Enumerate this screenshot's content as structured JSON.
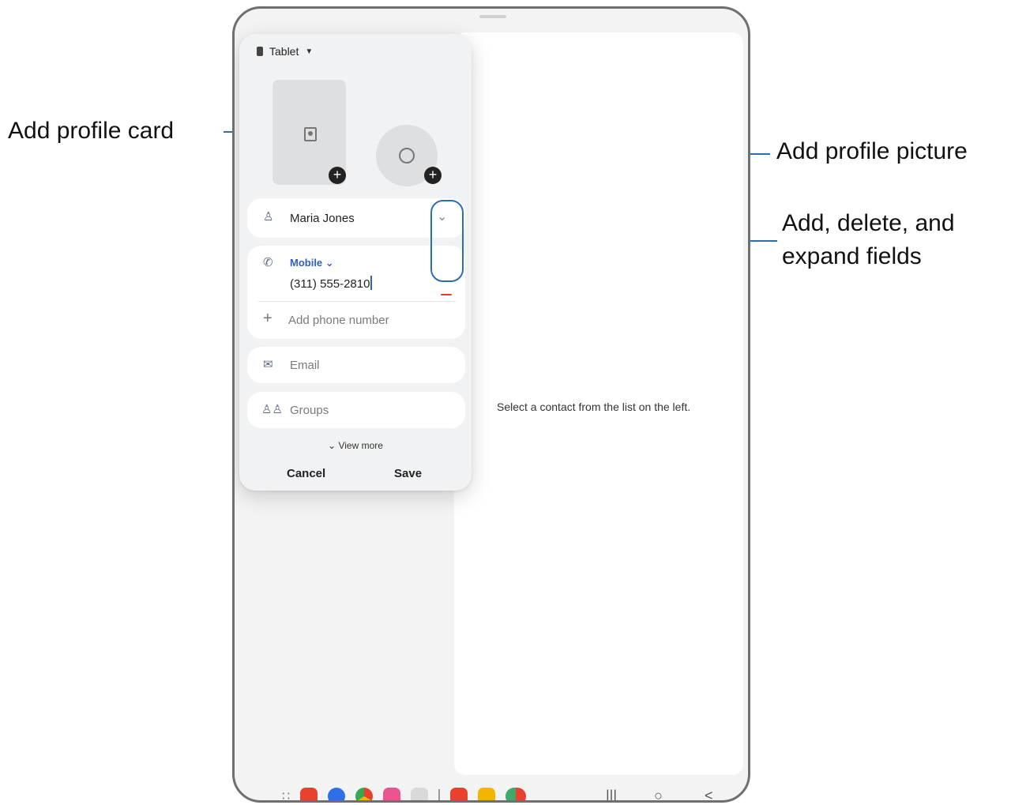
{
  "callouts": {
    "profile_card": "Add profile card",
    "profile_picture": "Add profile picture",
    "fields_line1": "Add, delete, and",
    "fields_line2": "expand fields"
  },
  "editor": {
    "account": "Tablet",
    "name_value": "Maria Jones",
    "phone_label": "Mobile",
    "phone_value": "(311) 555-2810",
    "add_phone": "Add phone number",
    "email_placeholder": "Email",
    "groups_placeholder": "Groups",
    "view_more": "View more",
    "cancel": "Cancel",
    "save": "Save"
  },
  "right_pane": {
    "message": "Select a contact from the list on the left."
  },
  "colors": {
    "accent": "#2f5fbf",
    "callout_line": "#2a6fb2",
    "delete": "#e53935"
  },
  "taskbar": {
    "apps": [
      {
        "icon": "apps-grid-icon",
        "color": "#777777"
      },
      {
        "icon": "notes-icon",
        "color": "#e8412d"
      },
      {
        "icon": "messages-icon",
        "color": "#2e6ee6"
      },
      {
        "icon": "chrome-icon",
        "color": "#f2b600"
      },
      {
        "icon": "bixby-icon",
        "color": "#e8558f"
      },
      {
        "icon": "camera-icon",
        "color": "#9a9a9a"
      },
      {
        "icon": "contacts-icon",
        "color": "#e8412d"
      },
      {
        "icon": "my-files-icon",
        "color": "#f2b600"
      },
      {
        "icon": "recent-apps-pair-icon",
        "color": "#e8412d"
      }
    ],
    "nav": [
      "recents-icon",
      "home-icon",
      "back-icon"
    ]
  }
}
